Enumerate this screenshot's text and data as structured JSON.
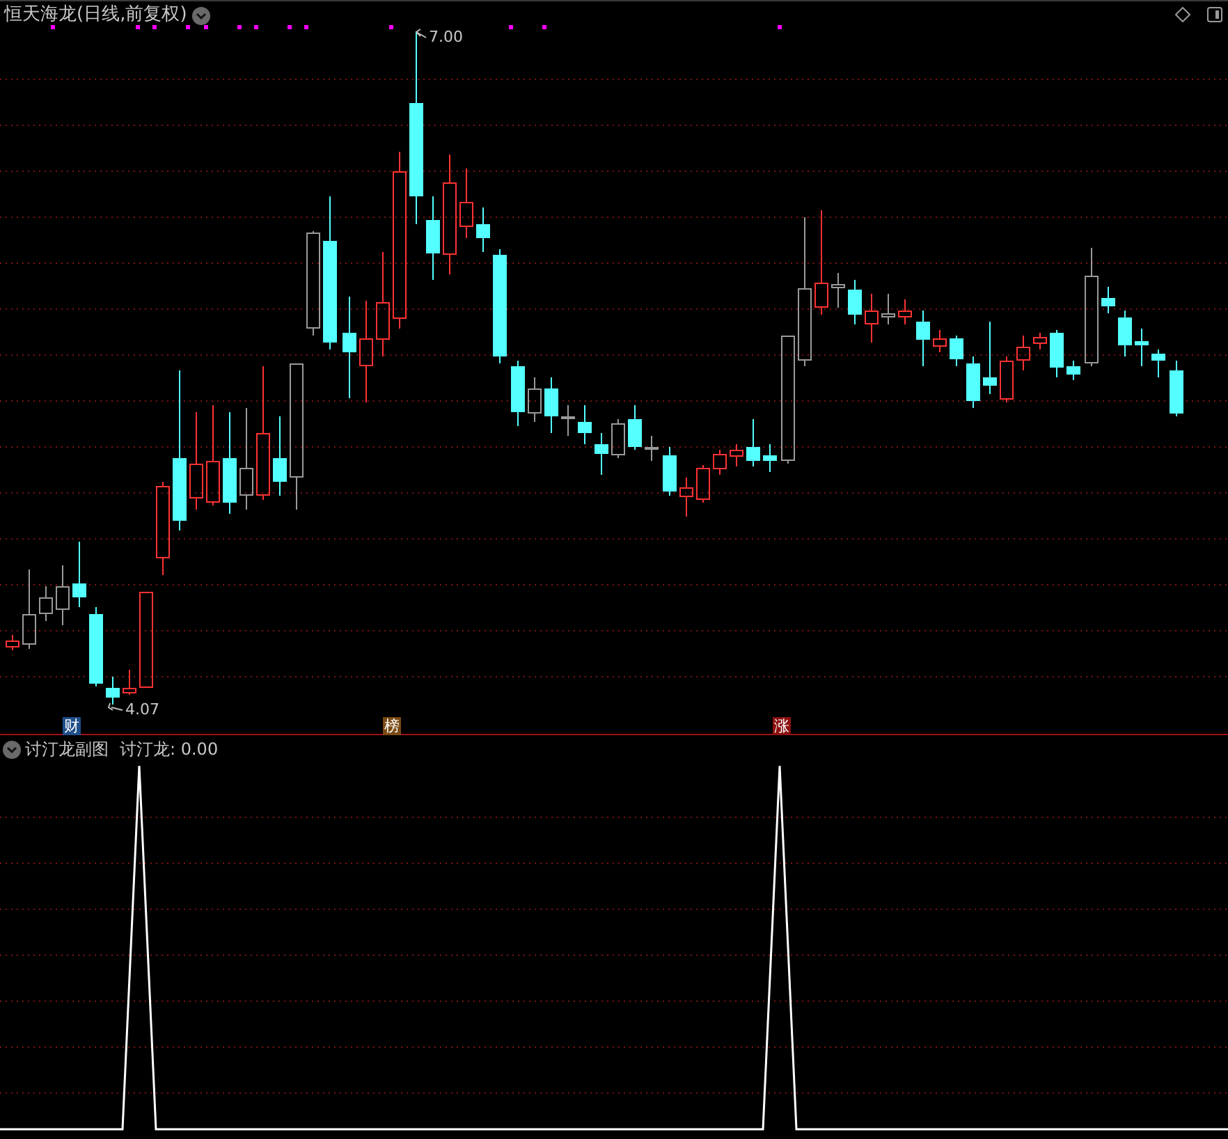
{
  "main_chart": {
    "title": "恒天海龙(日线,前复权)",
    "high_label": "7.00",
    "low_label": "4.07",
    "markers": [
      {
        "text": "财",
        "color": "#1f4e8a"
      },
      {
        "text": "榜",
        "color": "#7a4a14"
      },
      {
        "text": "涨",
        "color": "#8c1010"
      }
    ]
  },
  "sub_chart": {
    "title": "讨汀龙副图",
    "indicator": "讨汀龙: 0.00"
  }
}
